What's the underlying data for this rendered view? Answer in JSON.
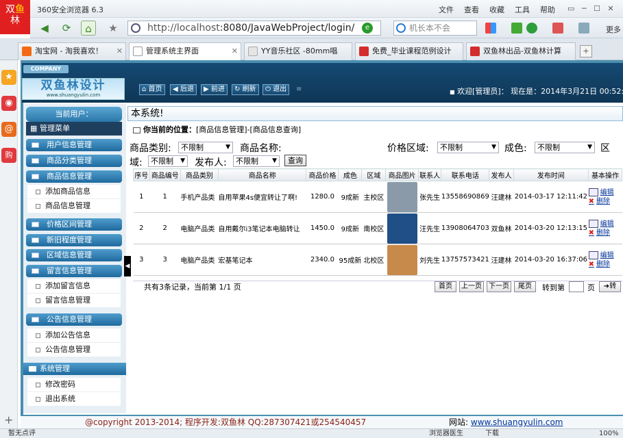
{
  "browser": {
    "logo_chars": [
      "双",
      "鱼",
      "林"
    ],
    "title": "360安全浏览器 6.3",
    "menu": [
      "文件",
      "查看",
      "收藏",
      "工具",
      "帮助"
    ],
    "url_host": "http://localhost",
    "url_path": ":8080/JavaWebProject/login/",
    "search_placeholder": "机长本不会",
    "more_label": "更多",
    "tabs": [
      {
        "label": "淘宝网 - 淘我喜欢！",
        "color": "#f26a16"
      },
      {
        "label": "管理系统主界面",
        "color": "#ffffff"
      },
      {
        "label": "YY音乐社区 -80mm唱",
        "color": "#e5e5e5"
      },
      {
        "label": "免费_毕业课程范例设计",
        "color": "#d22c2c"
      },
      {
        "label": "双鱼林出品-双鱼林计算",
        "color": "#d22c2c"
      }
    ],
    "status_left": "暂无点评",
    "status_right": "浏览器医生",
    "status_download": "下载",
    "zoom": "100%"
  },
  "app": {
    "company_badge": "COMPANY",
    "logo_text": "双鱼林设计",
    "logo_url": "www.shuangyulin.com",
    "toolbar": [
      "首页",
      "后退",
      "前进",
      "刷新",
      "退出"
    ],
    "welcome": "欢迎[管理员]： 现在是：2014年3月21日 00:52:10",
    "current_user_label": "当前用户：",
    "menu_title": "管理菜单",
    "crumb_title": "本系统!",
    "position_label": "你当前的位置：",
    "position_value": "[商品信息管理]-[商品信息查询]",
    "system_label": "系统管理"
  },
  "nav": [
    {
      "type": "head",
      "label": "用户信息管理"
    },
    {
      "type": "head",
      "label": "商品分类管理"
    },
    {
      "type": "head",
      "label": "商品信息管理"
    },
    {
      "type": "sub",
      "label": "添加商品信息"
    },
    {
      "type": "sub",
      "label": "商品信息管理"
    },
    {
      "type": "head",
      "label": "价格区间管理"
    },
    {
      "type": "head",
      "label": "新旧程度管理"
    },
    {
      "type": "head",
      "label": "区域信息管理"
    },
    {
      "type": "head",
      "label": "留言信息管理"
    },
    {
      "type": "sub",
      "label": "添加留言信息"
    },
    {
      "type": "sub",
      "label": "留言信息管理"
    },
    {
      "type": "head",
      "label": "公告信息管理"
    },
    {
      "type": "sub",
      "label": "添加公告信息"
    },
    {
      "type": "sub",
      "label": "公告信息管理"
    },
    {
      "type": "sub",
      "label": "修改密码"
    },
    {
      "type": "sub",
      "label": "退出系统"
    }
  ],
  "filters": {
    "category_label": "商品类别:",
    "category_value": "不限制",
    "name_label": "商品名称:",
    "price_label": "价格区域:",
    "price_value": "不限制",
    "color_label": "成色:",
    "color_value": "不限制",
    "area_label_a": "区",
    "area_label_b": "域:",
    "area_value": "不限制",
    "publisher_label": "发布人:",
    "publisher_value": "不限制",
    "query_button": "查询"
  },
  "table": {
    "headers": [
      "序号",
      "商品编号",
      "商品类别",
      "商品名称",
      "商品价格",
      "成色",
      "区域",
      "商品图片",
      "联系人",
      "联系电话",
      "发布人",
      "发布时间",
      "基本操作"
    ],
    "rows": [
      [
        "1",
        "1",
        "手机产品类",
        "自用苹果4s便宜转让了啊!",
        "1280.0",
        "9成新",
        "主校区",
        "",
        "张先生",
        "13558690869",
        "汪建林",
        "2014-03-17 12:11:42"
      ],
      [
        "2",
        "2",
        "电脑产品类",
        "自用戴尔i3笔记本电脑转让",
        "1450.0",
        "9成新",
        "南校区",
        "",
        "汪先生",
        "13908064703",
        "双鱼林",
        "2014-03-20 12:13:15"
      ],
      [
        "3",
        "3",
        "电脑产品类",
        "宏基笔记本",
        "2340.0",
        "95成新",
        "北校区",
        "",
        "刘先生",
        "13757573421",
        "汪建林",
        "2014-03-20 16:37:06"
      ]
    ],
    "thumb_colors": [
      "#8a9aa8",
      "#1f4f86",
      "#c88a4a"
    ],
    "edit_label": "编辑",
    "delete_label": "删除"
  },
  "pager": {
    "summary": "共有3条记录，当前第 1/1 页",
    "buttons": [
      "首页",
      "上一页",
      "下一页",
      "尾页"
    ],
    "goto_label": "转到第",
    "page_unit": "页",
    "go_label": "转"
  },
  "footer": {
    "copyright": "@copyright 2013-2014; 程序开发:双鱼林 QQ:287307421或254540457",
    "site_label": "网站:",
    "site_url": "www.shuangyulin.com"
  }
}
